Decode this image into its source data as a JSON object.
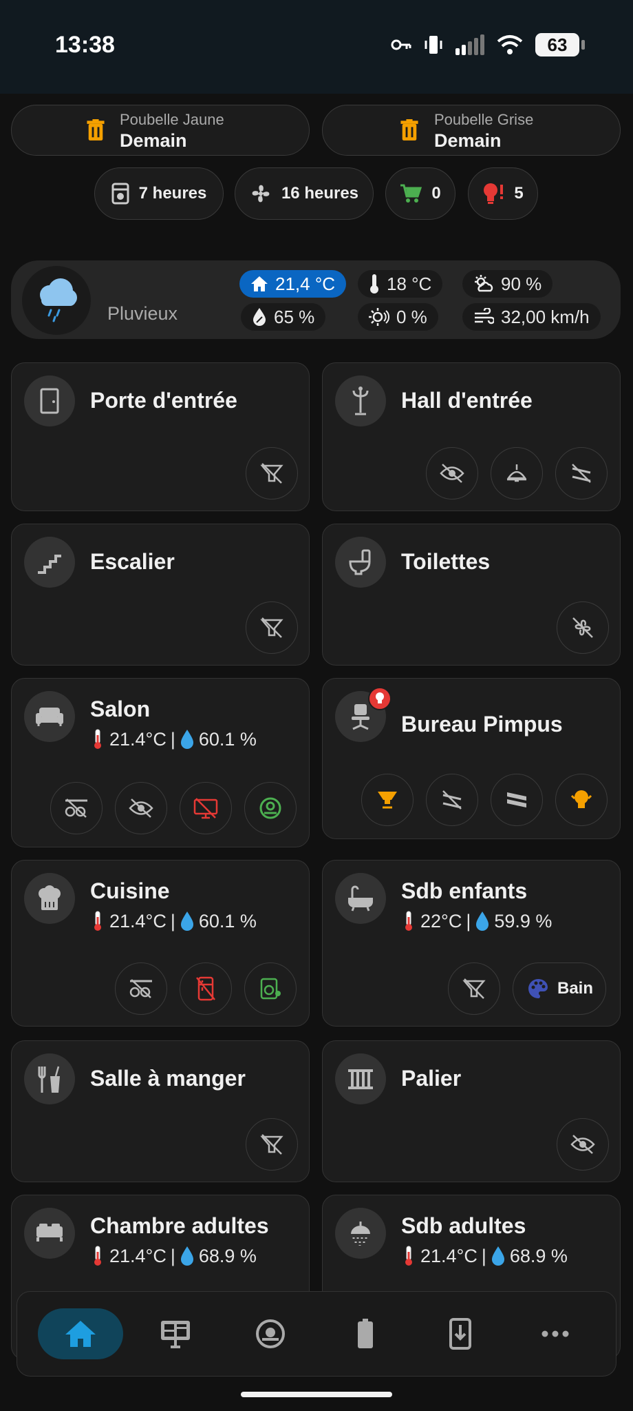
{
  "status_bar": {
    "time": "13:38",
    "battery": "63"
  },
  "bins": [
    {
      "label": "Poubelle Jaune",
      "value": "Demain",
      "color": "#f5a000"
    },
    {
      "label": "Poubelle Grise",
      "value": "Demain",
      "color": "#f5a000"
    }
  ],
  "chips": [
    {
      "icon": "dishwasher-icon",
      "text": "7 heures"
    },
    {
      "icon": "fan-icon",
      "text": "16 heures"
    },
    {
      "icon": "cart-icon",
      "text": "0",
      "color": "#4caf50"
    },
    {
      "icon": "lightbulb-alert-icon",
      "text": "5",
      "color": "#e53935"
    }
  ],
  "weather": {
    "condition": "Pluvieux",
    "indoor_temp": "21,4 °C",
    "outdoor_temp": "18 °C",
    "cloud_cover": "90 %",
    "humidity": "65 %",
    "uv": "0 %",
    "wind": "32,00 km/h",
    "highlight_color": "#0a66c2"
  },
  "rooms": {
    "porte": {
      "title": "Porte d'entrée"
    },
    "hall": {
      "title": "Hall d'entrée"
    },
    "escalier": {
      "title": "Escalier"
    },
    "toilettes": {
      "title": "Toilettes"
    },
    "salon": {
      "title": "Salon",
      "temp": "21.4°C",
      "sep": "|",
      "humidity": "60.1 %"
    },
    "bureau": {
      "title": "Bureau Pimpus"
    },
    "cuisine": {
      "title": "Cuisine",
      "temp": "21.4°C",
      "sep": "|",
      "humidity": "60.1 %"
    },
    "sdb_enfants": {
      "title": "Sdb enfants",
      "temp": "22°C",
      "sep": "|",
      "humidity": "59.9 %",
      "button": "Bain"
    },
    "salle_manger": {
      "title": "Salle à manger"
    },
    "palier": {
      "title": "Palier"
    },
    "chambre": {
      "title": "Chambre adultes",
      "temp": "21.4°C",
      "sep": "|",
      "humidity": "68.9 %"
    },
    "sdb_adultes": {
      "title": "Sdb adultes",
      "temp": "21.4°C",
      "sep": "|",
      "humidity": "68.9 %"
    }
  },
  "nav": [
    "home-icon",
    "monitor-dashboard-icon",
    "robot-vacuum-icon",
    "battery-icon",
    "cellphone-download-icon",
    "more-icon"
  ],
  "colors": {
    "accent_orange": "#f5a000",
    "accent_red": "#e53935",
    "accent_green": "#4caf50",
    "accent_blue": "#0a66c2",
    "nav_active": "#10445a"
  }
}
